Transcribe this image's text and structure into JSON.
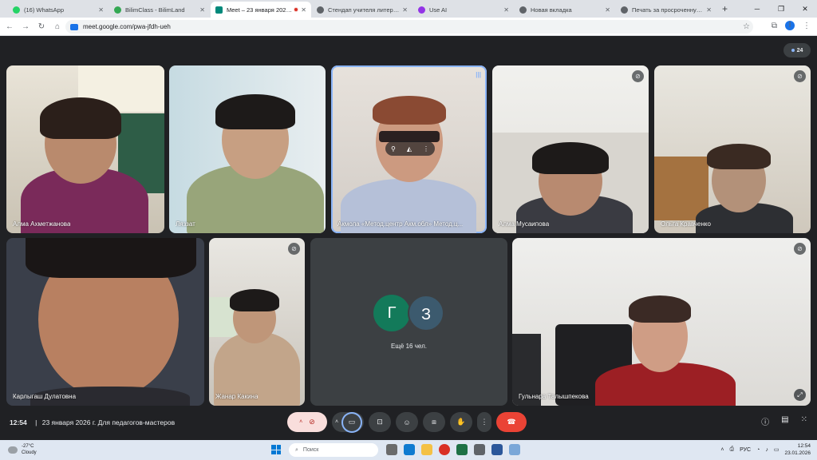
{
  "browser": {
    "tabs": [
      {
        "title": "(16) WhatsApp",
        "icon": "whatsapp-icon",
        "color": "#25d366"
      },
      {
        "title": "BilimClass - BilimLand",
        "icon": "bilimclass-icon",
        "color": "#34a853"
      },
      {
        "title": "Meet – 23 января 2026 г. Д",
        "icon": "meet-icon",
        "color": "#00897b",
        "active": true
      },
      {
        "title": "Стендап учителя литературы",
        "icon": "globe-icon",
        "color": "#5f6368"
      },
      {
        "title": "Use AI",
        "icon": "useai-icon",
        "color": "#9334e6"
      },
      {
        "title": "Новая вкладка",
        "icon": "chrome-icon",
        "color": "#5f6368"
      },
      {
        "title": "Печать за просроченную пре",
        "icon": "globe-icon",
        "color": "#5f6368"
      }
    ],
    "url": "meet.google.com/pwa-jfdh-ueh",
    "profile_initial": "I"
  },
  "meet": {
    "participant_count": "24",
    "tiles": [
      {
        "name": "Алма Ахметжанова"
      },
      {
        "name": "Ляззат"
      },
      {
        "name": "Акмола «Метод.центр Акм.обл» Метод.ц..."
      },
      {
        "name": "Алма Мусаипова"
      },
      {
        "name": "Ольга Кравченко"
      },
      {
        "name": "Карлыгаш Дулатовна"
      },
      {
        "name": "Жанар Какина"
      },
      {
        "name": "Гульнара Талышпекова"
      }
    ],
    "more": {
      "avatar1": "Г",
      "avatar2": "З",
      "avatar1_color": "#137a5a",
      "avatar2_color": "#3c5a6e",
      "label": "Ещё 16 чел."
    },
    "time": "12:54",
    "meeting_title": "23 января 2026 г. Для педагогов-мастеров"
  },
  "taskbar": {
    "temperature": "-27°C",
    "weather": "Cloudy",
    "search_placeholder": "Поиск",
    "lang": "РУС",
    "clock_time": "12:54",
    "clock_date": "23.01.2026"
  }
}
